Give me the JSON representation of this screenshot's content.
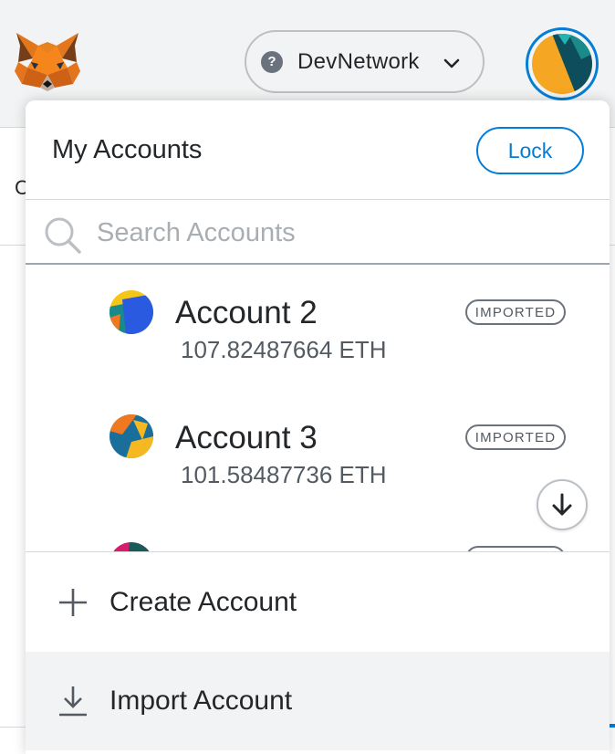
{
  "header": {
    "network_label": "DevNetwork",
    "network_icon": "question-mark"
  },
  "menu": {
    "title": "My Accounts",
    "lock_label": "Lock",
    "search_placeholder": "Search Accounts",
    "accounts": [
      {
        "name": "Account 2",
        "balance": "107.82487664 ETH",
        "badge": "IMPORTED"
      },
      {
        "name": "Account 3",
        "balance": "101.58487736 ETH",
        "badge": "IMPORTED"
      }
    ],
    "actions": {
      "create_label": "Create Account",
      "import_label": "Import Account"
    }
  },
  "colors": {
    "accent": "#037dd6",
    "header_bg": "#f2f3f4",
    "text": "#24272a"
  }
}
